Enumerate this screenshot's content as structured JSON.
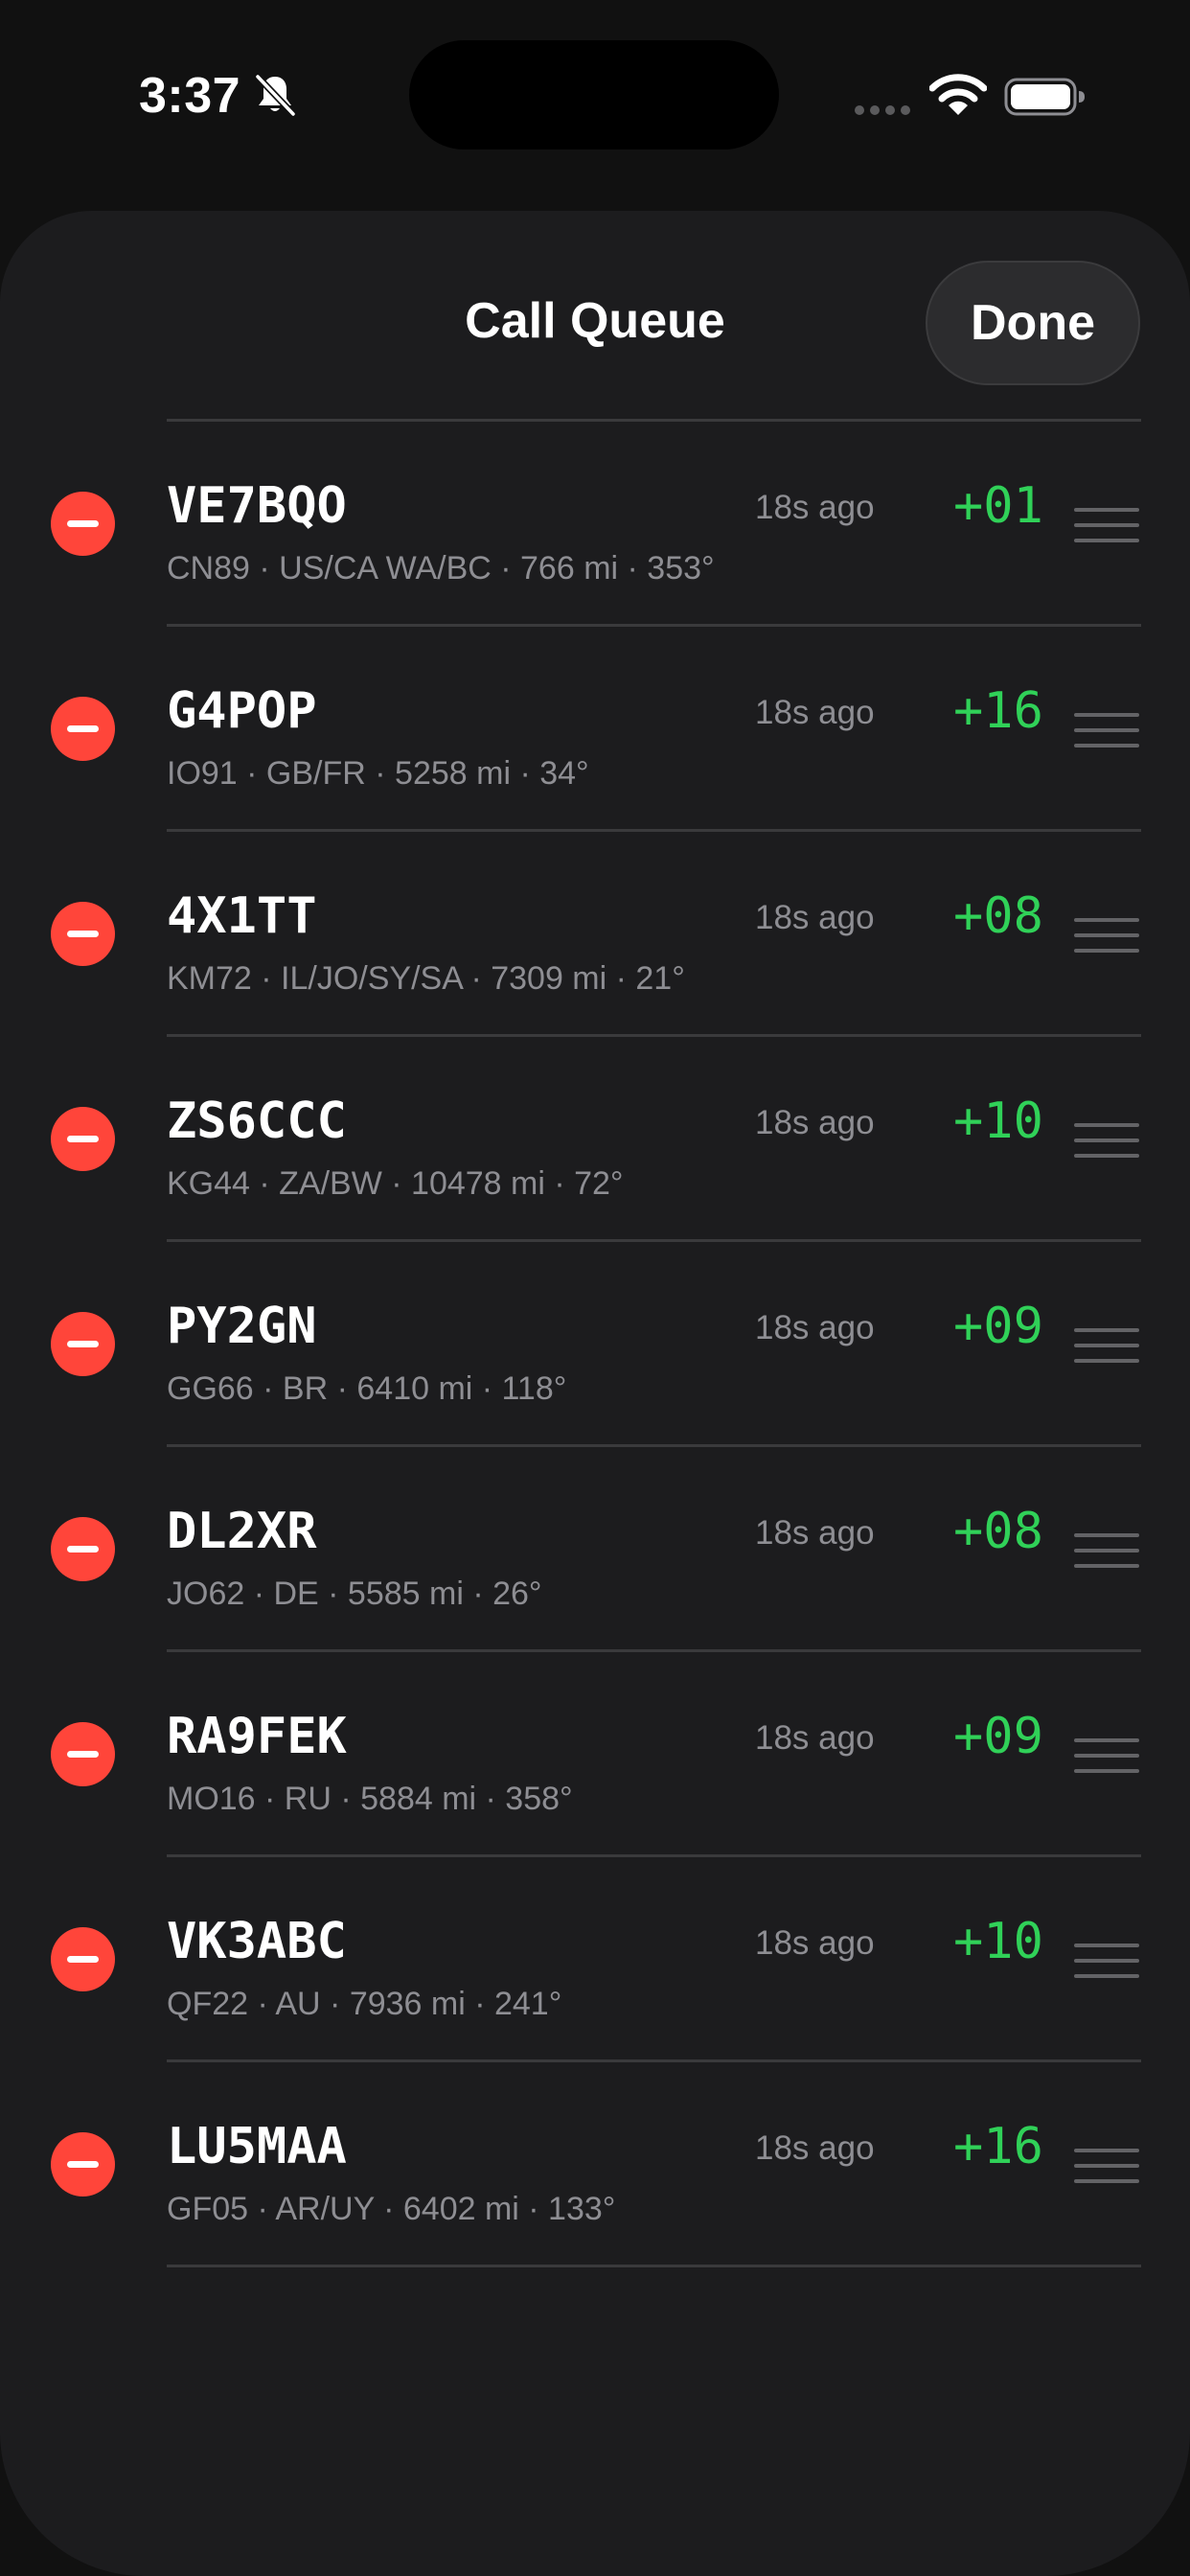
{
  "status_bar": {
    "time": "3:37",
    "icons": [
      "bell-slash-icon",
      "cellular-dots-icon",
      "wifi-icon",
      "battery-icon"
    ]
  },
  "sheet": {
    "title": "Call Queue",
    "done_label": "Done"
  },
  "colors": {
    "background": "#111111",
    "sheet": "#1c1c1e",
    "remove": "#ff453a",
    "snr": "#30d158",
    "secondary_text": "#8e8e93",
    "divider": "#3a3a3c"
  },
  "queue": [
    {
      "callsign": "VE7BQO",
      "details": "CN89 · US/CA WA/BC · 766 mi · 353°",
      "age": "18s ago",
      "snr": "+01"
    },
    {
      "callsign": "G4POP",
      "details": "IO91 · GB/FR · 5258 mi · 34°",
      "age": "18s ago",
      "snr": "+16"
    },
    {
      "callsign": "4X1TT",
      "details": "KM72 · IL/JO/SY/SA · 7309 mi · 21°",
      "age": "18s ago",
      "snr": "+08"
    },
    {
      "callsign": "ZS6CCC",
      "details": "KG44 · ZA/BW · 10478 mi · 72°",
      "age": "18s ago",
      "snr": "+10"
    },
    {
      "callsign": "PY2GN",
      "details": "GG66 · BR · 6410 mi · 118°",
      "age": "18s ago",
      "snr": "+09"
    },
    {
      "callsign": "DL2XR",
      "details": "JO62 · DE · 5585 mi · 26°",
      "age": "18s ago",
      "snr": "+08"
    },
    {
      "callsign": "RA9FEK",
      "details": "MO16 · RU · 5884 mi · 358°",
      "age": "18s ago",
      "snr": "+09"
    },
    {
      "callsign": "VK3ABC",
      "details": "QF22 · AU · 7936 mi · 241°",
      "age": "18s ago",
      "snr": "+10"
    },
    {
      "callsign": "LU5MAA",
      "details": "GF05 · AR/UY · 6402 mi · 133°",
      "age": "18s ago",
      "snr": "+16"
    }
  ]
}
